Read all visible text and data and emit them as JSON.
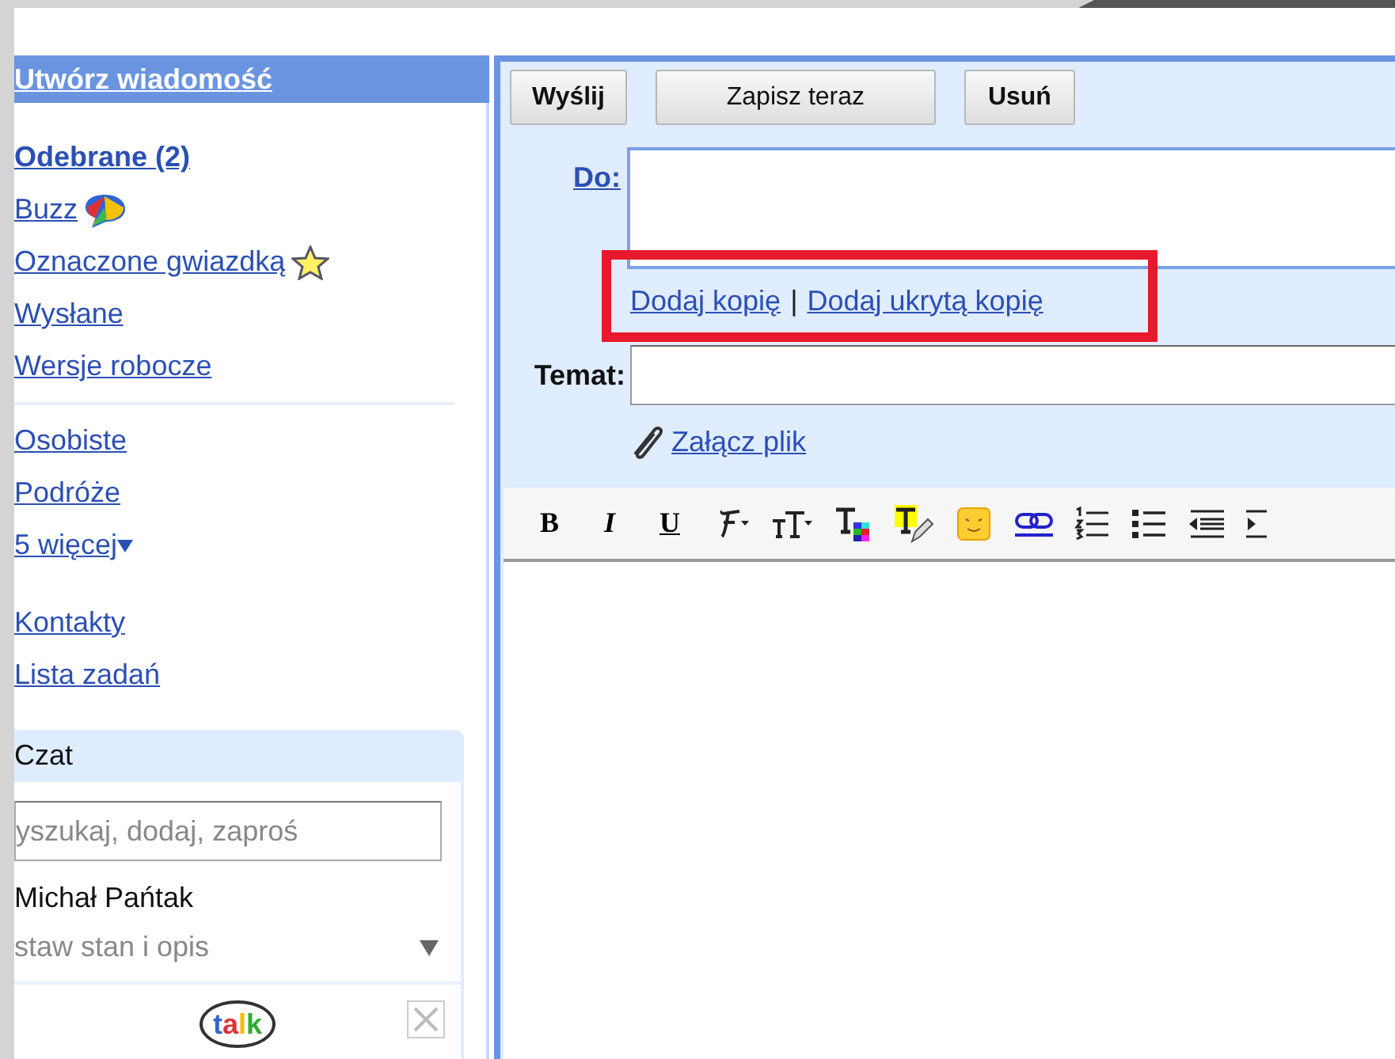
{
  "compose_link": "Utwórz wiadomość",
  "nav_primary": [
    {
      "label": "Odebrane (2)",
      "bold": true,
      "kind": "plain"
    },
    {
      "label": "Buzz",
      "bold": false,
      "kind": "buzz"
    },
    {
      "label": "Oznaczone gwiazdką",
      "bold": false,
      "kind": "starred"
    },
    {
      "label": "Wysłane",
      "bold": false,
      "kind": "plain"
    },
    {
      "label": "Wersje robocze",
      "bold": false,
      "kind": "plain"
    }
  ],
  "nav_labels": [
    {
      "label": "Osobiste",
      "caret": false
    },
    {
      "label": "Podróże",
      "caret": false
    },
    {
      "label": "5 więcej",
      "caret": true
    }
  ],
  "nav_extra": [
    "Kontakty",
    "Lista zadań"
  ],
  "chat": {
    "title": "Czat",
    "search": {
      "placeholder": "yszukaj, dodaj, zaproś"
    },
    "user_name": "Michał Pańtak",
    "status": "staw stan i opis",
    "logo": "talk"
  },
  "buttons": [
    "Wyślij",
    "Zapisz teraz",
    "Usuń"
  ],
  "to": {
    "label": "Do:"
  },
  "cc_links": [
    "Dodaj kopię",
    "Dodaj ukrytą kopię"
  ],
  "cc_separator": "|",
  "subject": {
    "label": "Temat:"
  },
  "attach": "Załącz plik",
  "toolbar": [
    {
      "kind": "text",
      "label": "B"
    },
    {
      "kind": "text",
      "label": "I"
    },
    {
      "kind": "text",
      "label": "U"
    },
    {
      "kind": "font"
    },
    {
      "kind": "size"
    },
    {
      "kind": "color"
    },
    {
      "kind": "highlight"
    },
    {
      "kind": "emoticon"
    },
    {
      "kind": "link"
    },
    {
      "kind": "numbered"
    },
    {
      "kind": "bullets"
    },
    {
      "kind": "outdent"
    },
    {
      "kind": "indent"
    }
  ]
}
